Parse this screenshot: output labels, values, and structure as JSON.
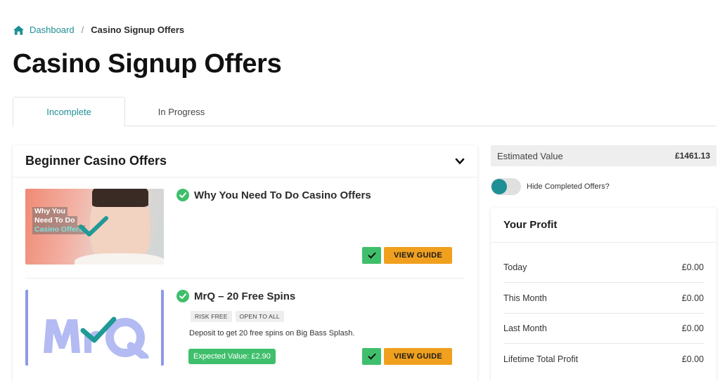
{
  "breadcrumb": {
    "home": "Dashboard",
    "separator": "/",
    "current": "Casino Signup Offers"
  },
  "page_title": "Casino Signup Offers",
  "tabs": [
    {
      "label": "Incomplete",
      "active": true
    },
    {
      "label": "In Progress",
      "active": false
    }
  ],
  "section": {
    "title": "Beginner Casino Offers"
  },
  "offers": [
    {
      "title": "Why You Need To Do Casino Offers",
      "thumb_lines": [
        "Why You",
        "Need To Do",
        "Casino Offers"
      ],
      "guide_label": "VIEW GUIDE",
      "completed": true
    },
    {
      "title": "MrQ – 20 Free Spins",
      "tags": [
        "RISK FREE",
        "OPEN TO ALL"
      ],
      "description": "Deposit to get 20 free spins on Big Bass Splash.",
      "expected_value": "Expected Value: £2.90",
      "guide_label": "VIEW GUIDE",
      "completed": true
    }
  ],
  "estimated": {
    "label": "Estimated Value",
    "value": "£1461.13"
  },
  "hide_completed": {
    "label": "Hide Completed Offers?",
    "on": true
  },
  "profit": {
    "title": "Your Profit",
    "rows": [
      {
        "label": "Today",
        "value": "£0.00"
      },
      {
        "label": "This Month",
        "value": "£0.00"
      },
      {
        "label": "Last Month",
        "value": "£0.00"
      },
      {
        "label": "Lifetime Total Profit",
        "value": "£0.00"
      }
    ]
  },
  "colors": {
    "accent": "#1f8f96",
    "success": "#3fbf6b",
    "guide": "#f0a01e",
    "mrq": "#8f98e8"
  },
  "icons": {
    "home": "home-icon",
    "chevron": "chevron-down-icon",
    "check": "check-circle-icon"
  }
}
